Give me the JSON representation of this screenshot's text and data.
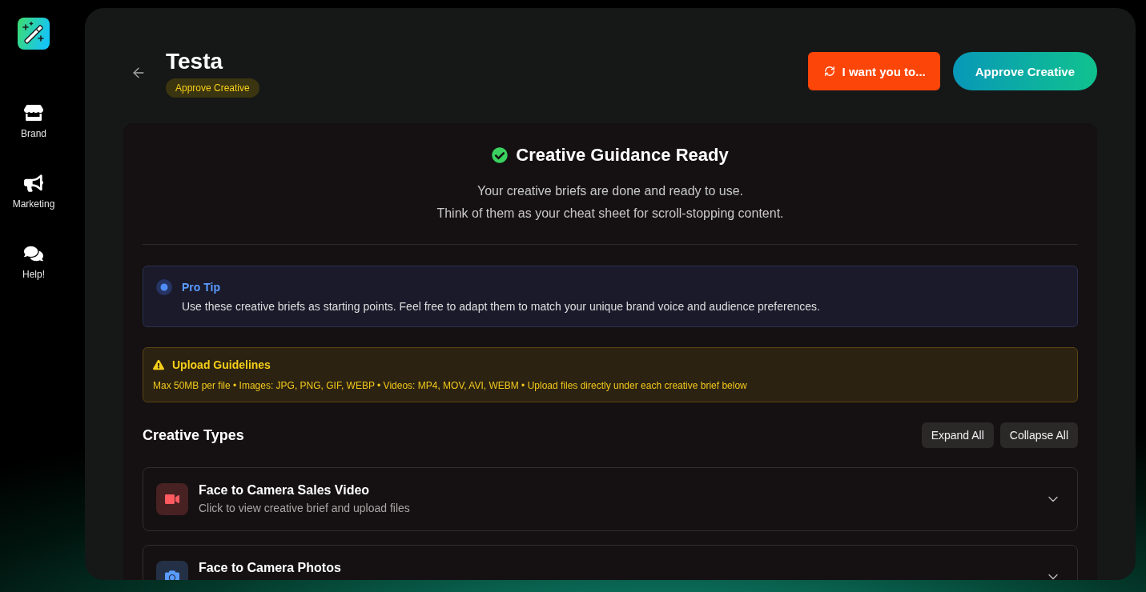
{
  "sidebar": {
    "items": [
      {
        "label": "Brand"
      },
      {
        "label": "Marketing"
      },
      {
        "label": "Help!"
      }
    ]
  },
  "header": {
    "title": "Testa",
    "status_badge": "Approve Creative",
    "buttons": [
      {
        "kind": "revise",
        "label": "I want you to..."
      },
      {
        "kind": "approve",
        "label": "Approve Creative"
      }
    ]
  },
  "guidance": {
    "title": "Creative Guidance Ready",
    "lines": [
      "Your creative briefs are done and ready to use.",
      "Think of them as your cheat sheet for scroll-stopping content."
    ]
  },
  "notices": [
    {
      "kind": "tip",
      "title": "Pro Tip",
      "text": "Use these creative briefs as starting points. Feel free to adapt them to match your unique brand voice and audience preferences."
    },
    {
      "kind": "warning",
      "title": "Upload Guidelines",
      "text": "Max 50MB per file • Images: JPG, PNG, GIF, WEBP • Videos: MP4, MOV, AVI, WEBM • Upload files directly under each creative brief below"
    }
  ],
  "creative_types": {
    "title": "Creative Types",
    "actions": [
      "Expand All",
      "Collapse All"
    ],
    "items": [
      {
        "title": "Face to Camera Sales Video",
        "subtitle": "Click to view creative brief and upload files",
        "color": "#ff5a5f",
        "expanded": false
      },
      {
        "title": "Face to Camera Photos",
        "color": "#5a9cff",
        "expanded": false
      }
    ]
  }
}
